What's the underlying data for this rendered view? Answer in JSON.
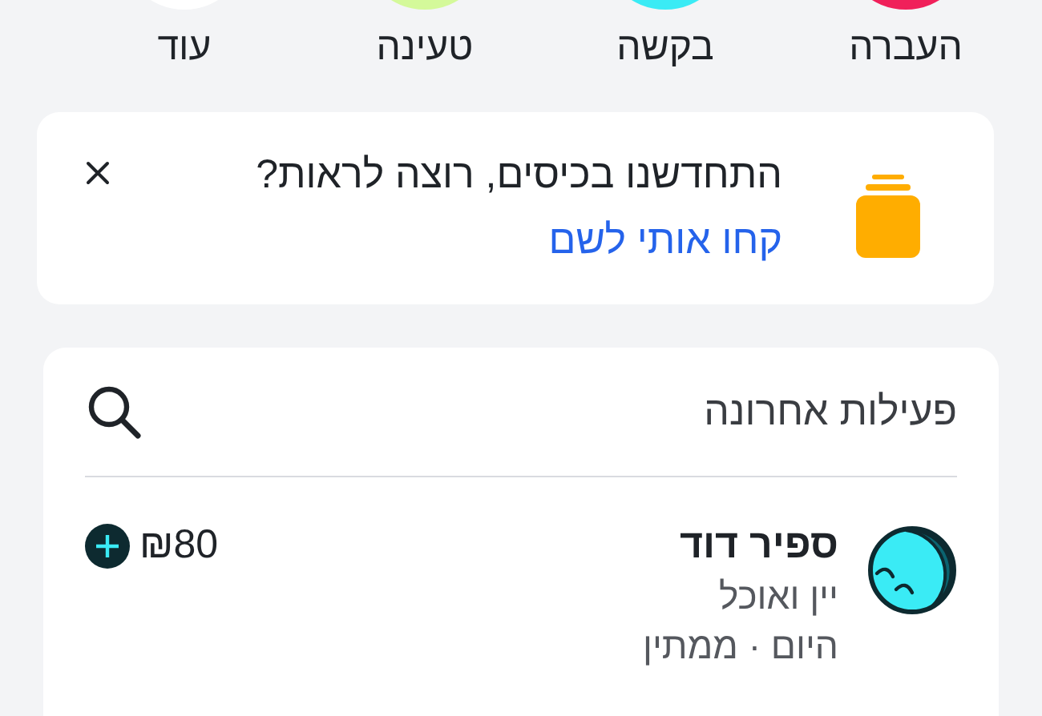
{
  "quick_actions": [
    {
      "label": "העברה",
      "color": "#f0205a"
    },
    {
      "label": "בקשה",
      "color": "#3aebf5"
    },
    {
      "label": "טעינה",
      "color": "#d4f99a"
    },
    {
      "label": "עוד",
      "color": "#ffffff"
    }
  ],
  "banner": {
    "title": "התחדשנו בכיסים, רוצה לראות?",
    "link": "קחו אותי לשם"
  },
  "recent_activity": {
    "title": "פעילות אחרונה",
    "items": [
      {
        "name": "ספיר דוד",
        "category": "יין ואוכל",
        "status": "היום · ממתין",
        "amount": "₪80"
      }
    ]
  }
}
